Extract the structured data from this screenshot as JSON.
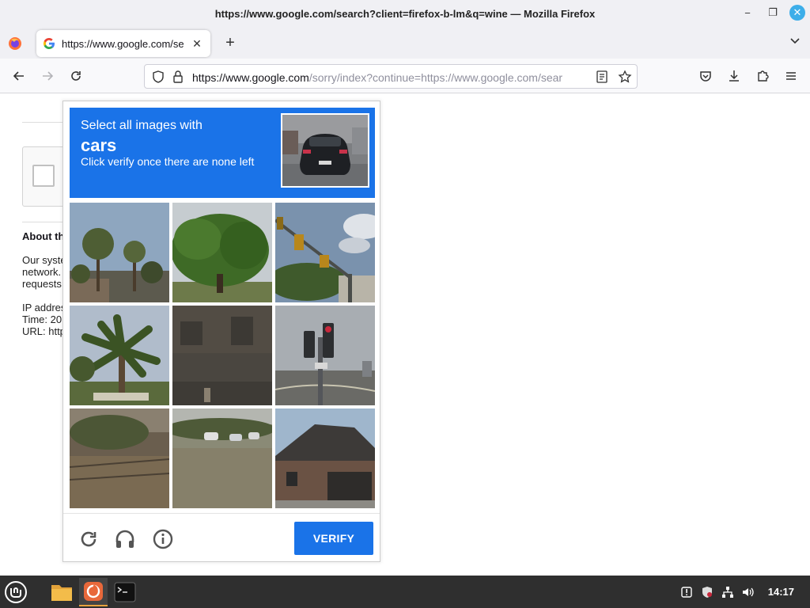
{
  "window": {
    "title": "https://www.google.com/search?client=firefox-b-lm&q=wine — Mozilla Firefox",
    "minimize_glyph": "−",
    "maximize_glyph": "❐",
    "close_glyph": "✕"
  },
  "tabs": {
    "active_title": "https://www.google.com/se",
    "close_glyph": "✕",
    "new_tab_glyph": "+",
    "list_glyph": "⌄"
  },
  "urlbar": {
    "host": "https://www.google.com",
    "path": "/sorry/index?continue=https://www.google.com/sear"
  },
  "page": {
    "about_label": "About th",
    "para_lines": [
      "Our syste",
      "network.",
      "requests"
    ],
    "info_lines": [
      "IP addres",
      "Time: 20",
      "URL: http"
    ]
  },
  "challenge": {
    "line1": "Select all images with",
    "target": "cars",
    "line3": "Click verify once there are none left",
    "verify_label": "VERIFY",
    "accent_color": "#1a73e8",
    "tiles": [
      {
        "name": "tile-palm-trees"
      },
      {
        "name": "tile-oak-tree"
      },
      {
        "name": "tile-traffic-lights-sky"
      },
      {
        "name": "tile-palm-tree"
      },
      {
        "name": "tile-brick-wall"
      },
      {
        "name": "tile-traffic-light-pole"
      },
      {
        "name": "tile-field-fence"
      },
      {
        "name": "tile-field-cars"
      },
      {
        "name": "tile-house"
      }
    ]
  },
  "taskbar": {
    "clock": "14:17"
  }
}
